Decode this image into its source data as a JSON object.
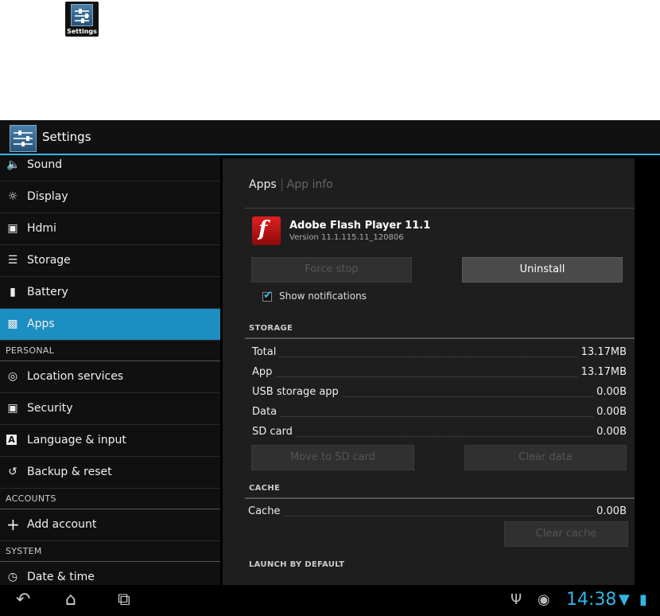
{
  "launcher": {
    "label": "Settings"
  },
  "action_bar": {
    "title": "Settings"
  },
  "sidebar": {
    "items": [
      {
        "label": "Sound",
        "icon": "speaker-icon"
      },
      {
        "label": "Display",
        "icon": "brightness-icon"
      },
      {
        "label": "Hdmi",
        "icon": "hdmi-icon"
      },
      {
        "label": "Storage",
        "icon": "storage-icon"
      },
      {
        "label": "Battery",
        "icon": "battery-icon"
      },
      {
        "label": "Apps",
        "icon": "apps-icon",
        "selected": true
      }
    ],
    "personal_header": "PERSONAL",
    "personal": [
      {
        "label": "Location services",
        "icon": "location-icon"
      },
      {
        "label": "Security",
        "icon": "lock-icon"
      },
      {
        "label": "Language & input",
        "icon": "keyboard-icon"
      },
      {
        "label": "Backup & reset",
        "icon": "backup-icon"
      }
    ],
    "accounts_header": "ACCOUNTS",
    "add_account": "Add account",
    "system_header": "SYSTEM",
    "date_time": "Date & time"
  },
  "content": {
    "breadcrumb": {
      "current": "Apps",
      "next": "App info"
    },
    "app": {
      "name": "Adobe Flash Player 11.1",
      "version": "Version 11.1.115.11_120806"
    },
    "buttons": {
      "force_stop": "Force stop",
      "uninstall": "Uninstall"
    },
    "show_notifications": {
      "label": "Show notifications",
      "checked": true
    },
    "storage_header": "STORAGE",
    "storage_rows": [
      {
        "label": "Total",
        "value": "13.17MB"
      },
      {
        "label": "App",
        "value": "13.17MB"
      },
      {
        "label": "USB storage app",
        "value": "0.00B"
      },
      {
        "label": "Data",
        "value": "0.00B"
      },
      {
        "label": "SD card",
        "value": "0.00B"
      }
    ],
    "move_to_sd": "Move to SD card",
    "clear_data": "Clear data",
    "cache_header": "CACHE",
    "cache_row": {
      "label": "Cache",
      "value": "0.00B"
    },
    "clear_cache": "Clear cache",
    "launch_header": "LAUNCH BY DEFAULT"
  },
  "status": {
    "time": "14:38",
    "accent": "#33b5e5"
  }
}
